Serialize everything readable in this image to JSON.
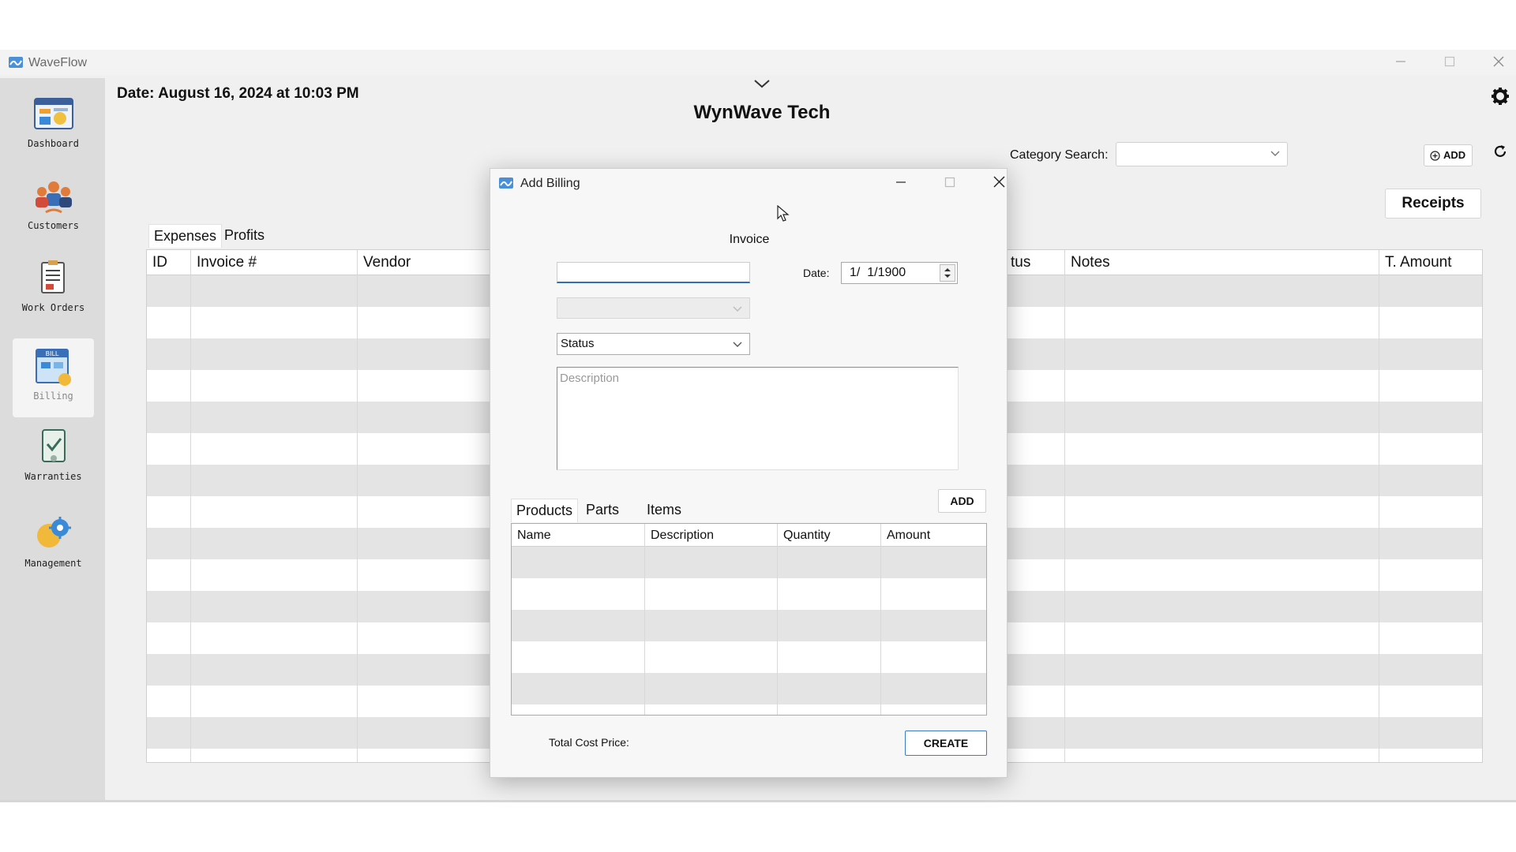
{
  "window": {
    "app_title": "WaveFlow"
  },
  "sidebar": {
    "items": [
      {
        "label": "Dashboard",
        "active": false
      },
      {
        "label": "Customers",
        "active": false
      },
      {
        "label": "Work Orders",
        "active": false
      },
      {
        "label": "Billing",
        "active": true
      },
      {
        "label": "Warranties",
        "active": false
      },
      {
        "label": "Management",
        "active": false
      }
    ]
  },
  "header": {
    "date_text": "Date: August 16, 2024 at 10:03 PM",
    "company": "WynWave Tech",
    "category_search_label": "Category Search:",
    "category_search_value": "",
    "add_label": "ADD",
    "receipts_label": "Receipts"
  },
  "main": {
    "tabs": [
      {
        "label": "Expenses",
        "active": true
      },
      {
        "label": "Profits",
        "active": false
      }
    ],
    "columns": [
      "ID",
      "Invoice #",
      "Vendor",
      "tus",
      "Notes",
      "T. Amount"
    ],
    "rows": []
  },
  "dialog": {
    "title": "Add Billing",
    "invoice_label": "Invoice",
    "invoice_value": "",
    "date_label": "Date:",
    "date_value": "1/  1/1900",
    "select1_value": "",
    "status_placeholder": "Status",
    "description_placeholder": "Description",
    "tabs": [
      {
        "label": "Products",
        "active": true
      },
      {
        "label": "Parts",
        "active": false
      },
      {
        "label": "Items",
        "active": false
      }
    ],
    "add_label": "ADD",
    "columns": [
      "Name",
      "Description",
      "Quantity",
      "Amount"
    ],
    "rows": [],
    "total_label": "Total Cost Price:",
    "create_label": "CREATE"
  },
  "colors": {
    "accent_blue": "#2f6fb6",
    "row_alt": "#e4e4e4",
    "sidebar_bg": "#dcdcdc"
  }
}
